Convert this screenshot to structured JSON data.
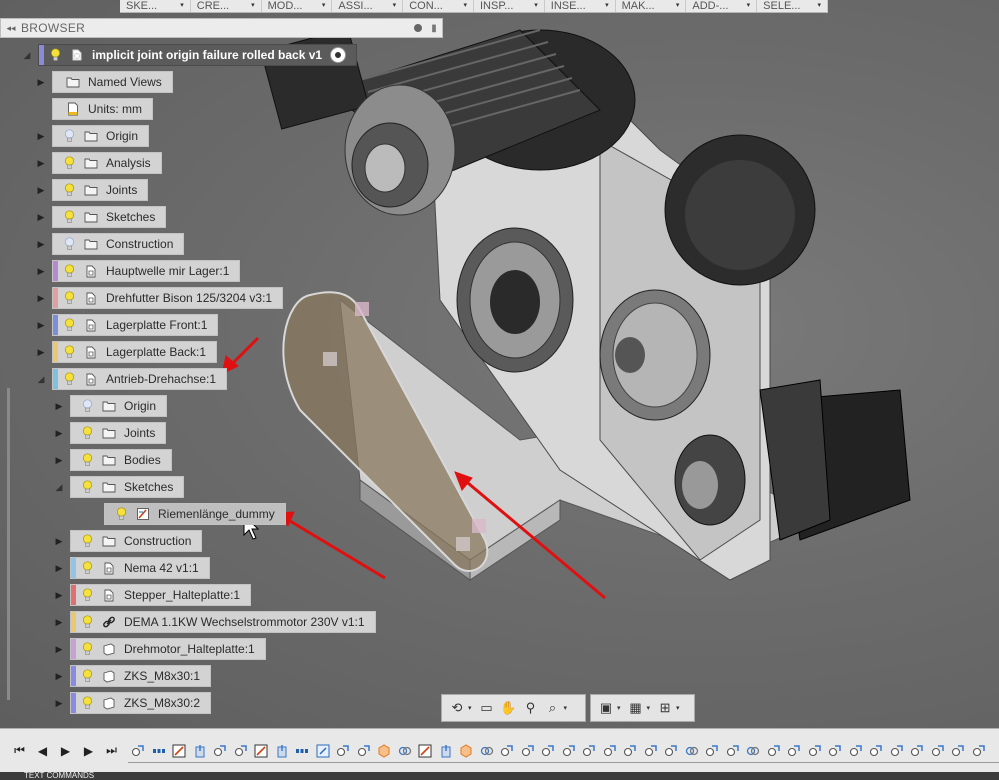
{
  "toolbar": {
    "menus": [
      "SKE...",
      "CRE...",
      "MOD...",
      "ASSI...",
      "CON...",
      "INSP...",
      "INSE...",
      "MAK...",
      "ADD-...",
      "SELE..."
    ]
  },
  "browser": {
    "title": "BROWSER",
    "root_label": "implicit joint origin failure rolled back v1",
    "rows": [
      {
        "label": "Named Views",
        "indent": 0,
        "icon": "folder-icon",
        "bulb": false,
        "stripe": ""
      },
      {
        "label": "Units: mm",
        "indent": 0,
        "icon": "document-icon",
        "bulb": false,
        "stripe": "",
        "no_twisty": true
      },
      {
        "label": "Origin",
        "indent": 0,
        "icon": "folder-icon",
        "bulb": "off",
        "stripe": ""
      },
      {
        "label": "Analysis",
        "indent": 0,
        "icon": "folder-icon",
        "bulb": "on",
        "stripe": ""
      },
      {
        "label": "Joints",
        "indent": 0,
        "icon": "folder-icon",
        "bulb": "on",
        "stripe": ""
      },
      {
        "label": "Sketches",
        "indent": 0,
        "icon": "folder-icon",
        "bulb": "on",
        "stripe": ""
      },
      {
        "label": "Construction",
        "indent": 0,
        "icon": "folder-icon",
        "bulb": "off",
        "stripe": ""
      },
      {
        "label": "Hauptwelle mir Lager:1",
        "indent": 0,
        "icon": "component-icon",
        "bulb": "on",
        "stripe": "#b48ad0"
      },
      {
        "label": "Drehfutter Bison 125/3204 v3:1",
        "indent": 0,
        "icon": "component-icon",
        "bulb": "on",
        "stripe": "#e0a0a0"
      },
      {
        "label": "Lagerplatte Front:1",
        "indent": 0,
        "icon": "component-icon",
        "bulb": "on",
        "stripe": "#7a8fd8"
      },
      {
        "label": "Lagerplatte Back:1",
        "indent": 0,
        "icon": "component-icon",
        "bulb": "on",
        "stripe": "#e8c870"
      },
      {
        "label": "Antrieb-Drehachse:1",
        "indent": 0,
        "icon": "component-icon",
        "bulb": "on",
        "stripe": "#7fc1e0",
        "open": true
      },
      {
        "label": "Origin",
        "indent": 1,
        "icon": "folder-icon",
        "bulb": "off",
        "stripe": ""
      },
      {
        "label": "Joints",
        "indent": 1,
        "icon": "folder-icon",
        "bulb": "on",
        "stripe": ""
      },
      {
        "label": "Bodies",
        "indent": 1,
        "icon": "folder-icon",
        "bulb": "on",
        "stripe": ""
      },
      {
        "label": "Sketches",
        "indent": 1,
        "icon": "folder-icon",
        "bulb": "on",
        "stripe": "",
        "open": true
      },
      {
        "label": "Riemenlänge_dummy",
        "indent": 2,
        "icon": "sketch-icon",
        "bulb": "on",
        "stripe": "",
        "no_twisty": true,
        "selected": true
      },
      {
        "label": "Construction",
        "indent": 1,
        "icon": "folder-icon",
        "bulb": "on",
        "stripe": ""
      },
      {
        "label": "Nema 42 v1:1",
        "indent": 1,
        "icon": "component-icon",
        "bulb": "on",
        "stripe": "#8fc6e8"
      },
      {
        "label": "Stepper_Halteplatte:1",
        "indent": 1,
        "icon": "component-icon",
        "bulb": "on",
        "stripe": "#e07070"
      },
      {
        "label": "DEMA 1.1KW Wechselstrommotor 230V v1:1",
        "indent": 1,
        "icon": "link-icon",
        "bulb": "on",
        "stripe": "#e8c870"
      },
      {
        "label": "Drehmotor_Halteplatte:1",
        "indent": 1,
        "icon": "body-icon",
        "bulb": "on",
        "stripe": "#c9a0d8"
      },
      {
        "label": "ZKS_M8x30:1",
        "indent": 1,
        "icon": "body-icon",
        "bulb": "on",
        "stripe": "#8a8ae0"
      },
      {
        "label": "ZKS_M8x30:2",
        "indent": 1,
        "icon": "body-icon",
        "bulb": "on",
        "stripe": "#8a8ae0"
      }
    ]
  },
  "navbar": {
    "groups": [
      {
        "icons": [
          "orbit-icon",
          "look-at-icon",
          "pan-icon",
          "zoom-icon",
          "fit-icon"
        ]
      },
      {
        "icons": [
          "display-settings-icon",
          "grid-icon",
          "viewports-icon"
        ]
      }
    ]
  },
  "timeline": {
    "controls": [
      "go-to-start-icon",
      "step-back-icon",
      "play-icon",
      "step-forward-icon",
      "go-to-end-icon"
    ],
    "features": [
      "joint",
      "pattern",
      "sketch",
      "extrude",
      "joint",
      "joint",
      "sketch",
      "extrude",
      "pattern",
      "move",
      "joint",
      "joint",
      "component",
      "rigid",
      "sketch",
      "extrude",
      "component",
      "rigid",
      "joint",
      "joint",
      "joint",
      "joint",
      "joint",
      "joint",
      "joint",
      "joint",
      "joint",
      "rigid",
      "joint",
      "joint",
      "rigid",
      "joint",
      "joint",
      "joint",
      "joint",
      "joint",
      "joint",
      "joint",
      "joint",
      "joint",
      "joint",
      "joint"
    ]
  },
  "statusbar": {
    "text": "TEXT COMMANDS"
  },
  "colors": {
    "accent": "#1e73be",
    "panel": "#d3d3d3",
    "panel_dark": "#5b5b5b"
  }
}
